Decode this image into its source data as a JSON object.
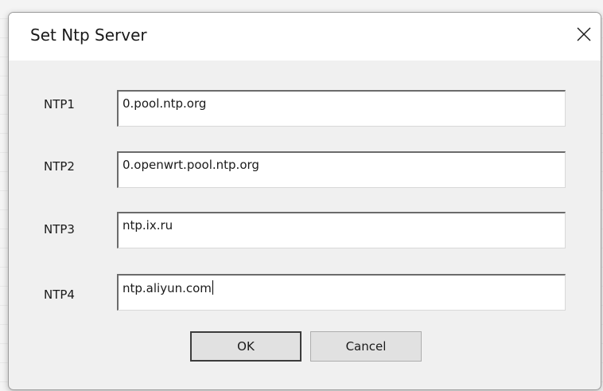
{
  "dialog": {
    "title": "Set Ntp Server",
    "close_icon": "close-icon"
  },
  "fields": [
    {
      "label": "NTP1",
      "value": "0.pool.ntp.org"
    },
    {
      "label": "NTP2",
      "value": "0.openwrt.pool.ntp.org"
    },
    {
      "label": "NTP3",
      "value": "ntp.ix.ru"
    },
    {
      "label": "NTP4",
      "value": "ntp.aliyun.com"
    }
  ],
  "buttons": {
    "ok_label": "OK",
    "cancel_label": "Cancel"
  }
}
